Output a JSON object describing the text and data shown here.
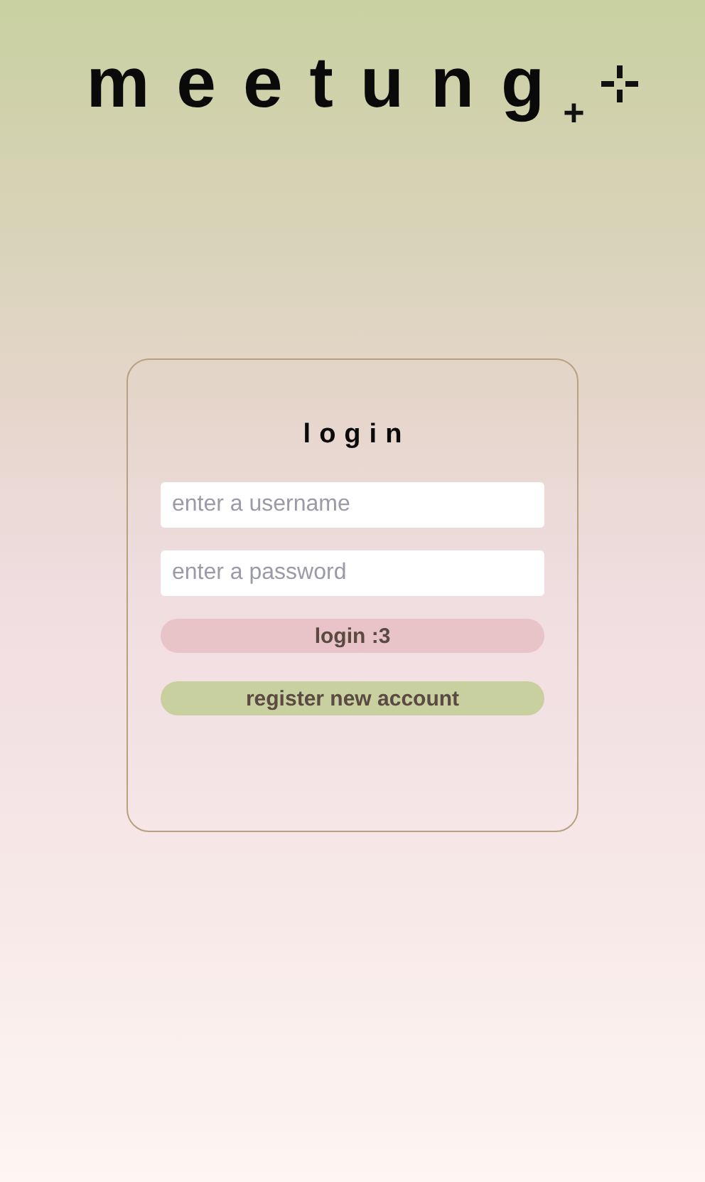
{
  "logo": {
    "text": "meetung",
    "mark": "+"
  },
  "login_card": {
    "title": "login",
    "fields": [
      {
        "placeholder": "enter a username"
      },
      {
        "placeholder": "enter a password"
      }
    ],
    "buttons": [
      {
        "label": "login :3",
        "kind": "primary"
      },
      {
        "label": "register new account",
        "kind": "secondary"
      }
    ]
  }
}
